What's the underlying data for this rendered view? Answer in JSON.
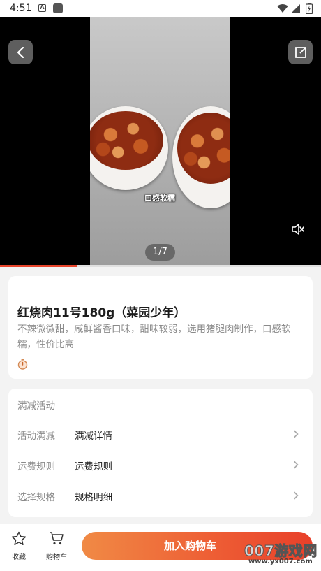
{
  "status_bar": {
    "time": "4:51",
    "notification_letter": "A"
  },
  "media": {
    "caption": "口感软糯",
    "counter": "1/7",
    "progress_fraction": 0.24
  },
  "product": {
    "title": "红烧肉11号180g（菜园少年）",
    "description": "不辣微微甜，咸鲜酱香口味，甜味较弱，选用猪腿肉制作，口感软糯，性价比高"
  },
  "promotions": {
    "header": "满减活动",
    "rows": [
      {
        "label": "活动满减",
        "value": "满减详情"
      },
      {
        "label": "运费规则",
        "value": "运费规则"
      },
      {
        "label": "选择规格",
        "value": "规格明细"
      }
    ]
  },
  "bottom_bar": {
    "favorite_label": "收藏",
    "cart_label": "购物车",
    "add_to_cart_label": "加入购物车"
  },
  "watermark": {
    "brand": "007游戏网",
    "url": "www.yx007.com"
  },
  "colors": {
    "accent": "#e8452c",
    "gradient_start": "#f08a45"
  }
}
